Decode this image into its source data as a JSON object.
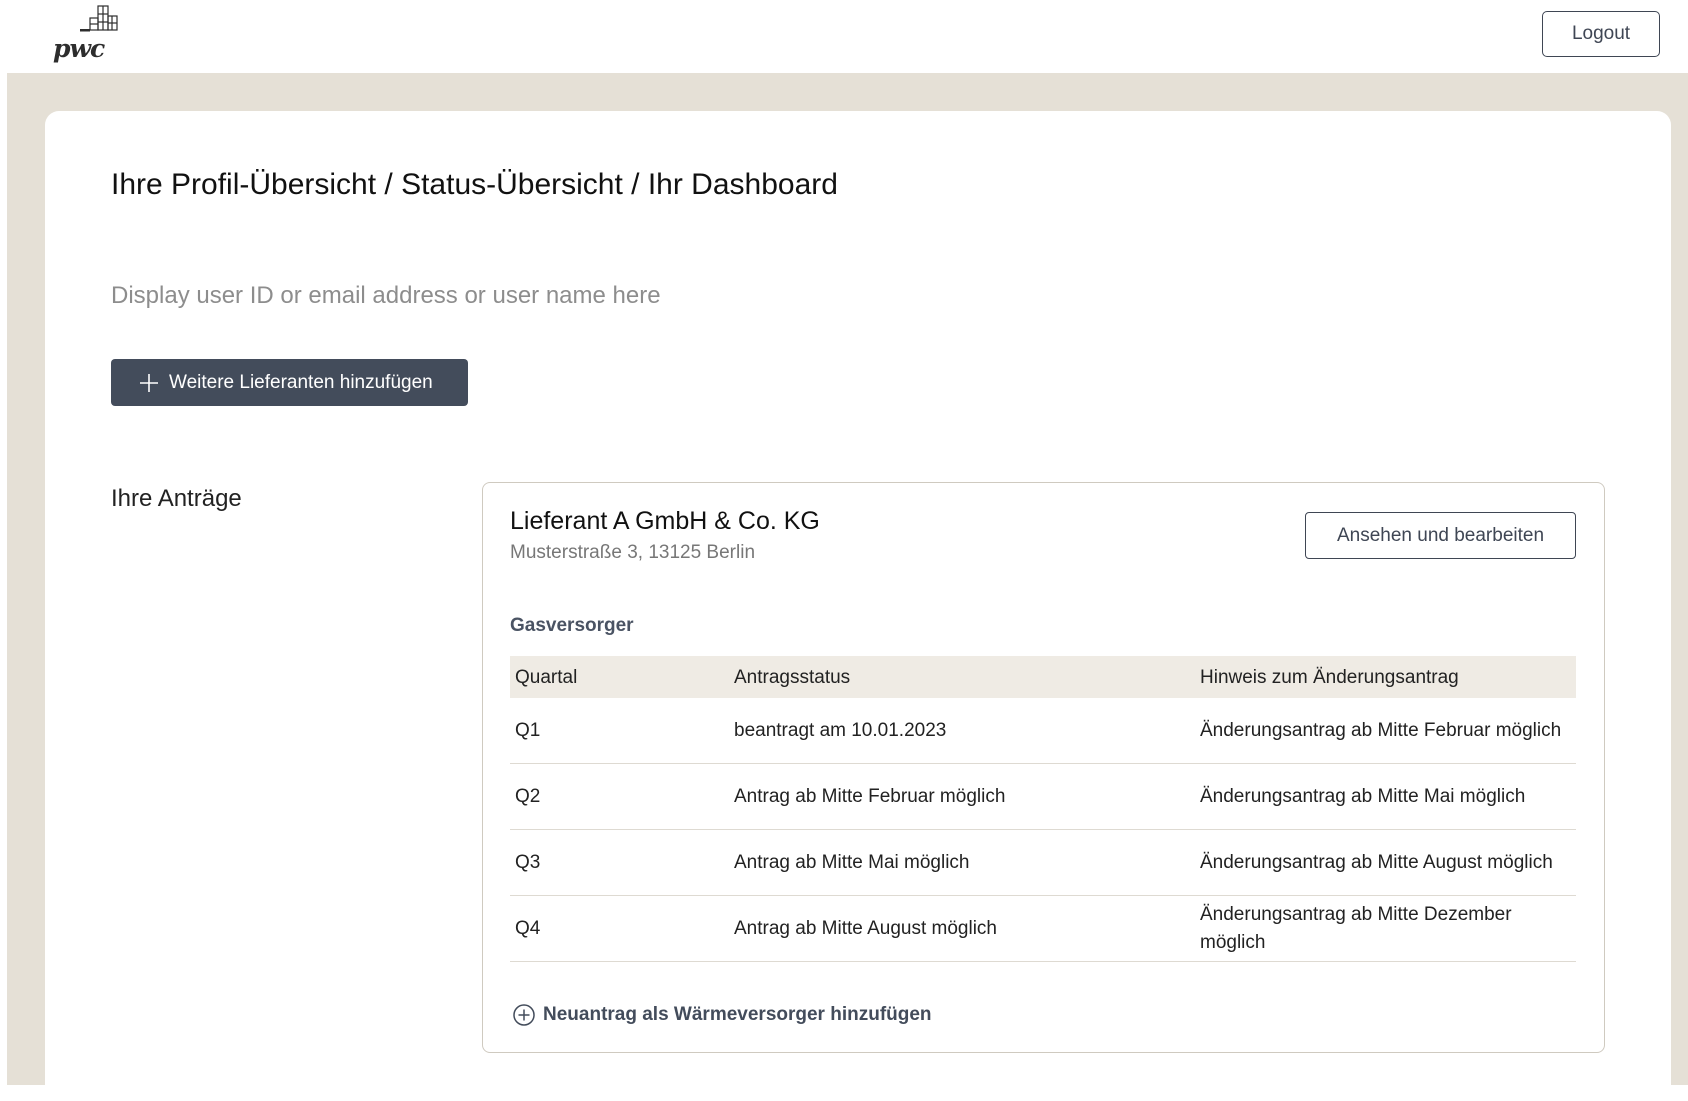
{
  "header": {
    "logo_text": "pwc",
    "logout_label": "Logout"
  },
  "page": {
    "title": "Ihre Profil-Übersicht / Status-Übersicht / Ihr Dashboard",
    "user_placeholder": "Display user ID or email address or user name here",
    "add_supplier_label": "Weitere Lieferanten hinzufügen",
    "section_label": "Ihre Anträge"
  },
  "application": {
    "supplier_name": "Lieferant A GmbH & Co. KG",
    "supplier_address": "Musterstraße 3, 13125 Berlin",
    "view_edit_label": "Ansehen und bearbeiten",
    "provider_type": "Gasversorger",
    "table": {
      "headers": [
        "Quartal",
        "Antragsstatus",
        "Hinweis zum Änderungsantrag"
      ],
      "rows": [
        [
          "Q1",
          "beantragt am 10.01.2023",
          "Änderungsantrag ab Mitte Februar möglich"
        ],
        [
          "Q2",
          "Antrag ab Mitte Februar möglich",
          "Änderungsantrag ab Mitte Mai möglich"
        ],
        [
          "Q3",
          "Antrag ab Mitte Mai möglich",
          "Änderungsantrag ab Mitte August möglich"
        ],
        [
          "Q4",
          "Antrag ab Mitte August möglich",
          "Änderungsantrag ab Mitte Dezember möglich"
        ]
      ]
    },
    "new_application_label": "Neuantrag als Wärmeversorger hinzufügen"
  },
  "icons": {
    "logo": "pwc-building-logo",
    "add": "plus-icon",
    "new_application": "circle-plus-icon"
  },
  "colors": {
    "primary_button": "#434c5b",
    "backdrop": "#e5e0d6",
    "table_header": "#efebe4"
  }
}
